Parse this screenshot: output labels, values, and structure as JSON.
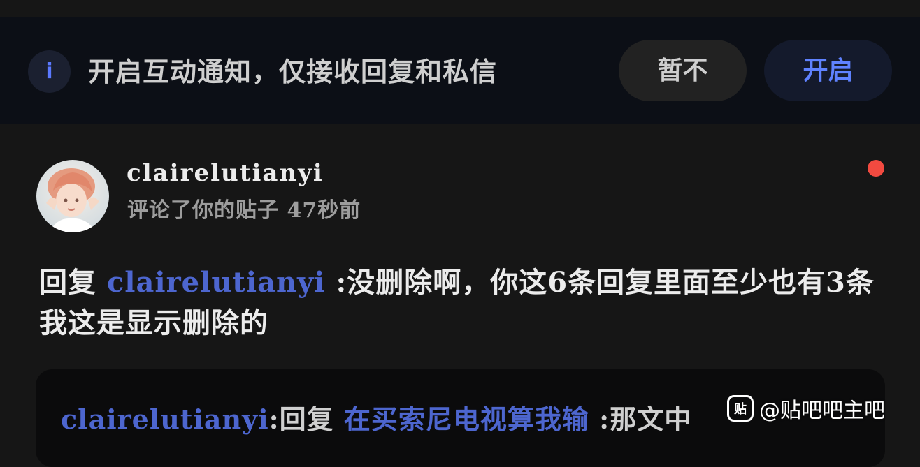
{
  "notice": {
    "icon": "info-icon",
    "icon_glyph": "i",
    "text": "开启互动通知，仅接收回复和私信",
    "later_label": "暂不",
    "enable_label": "开启",
    "accent": "#5f82ff"
  },
  "notification": {
    "avatar_icon": "avatar-photo",
    "username": "clairelutianyi",
    "action": "评论了你的贴子",
    "time": "47秒前",
    "unread_dot_color": "#f24a40",
    "reply_prefix": "回复 ",
    "reply_mention": "clairelutianyi",
    "reply_body": " :没删除啊，你这6条回复里面至少也有3条我这是显示删除的",
    "quote": {
      "user": "clairelutianyi",
      "sep": ":回复 ",
      "link": "在买索尼电视算我输",
      "tail": " :那文中"
    }
  },
  "watermark": {
    "logo_text": "贴",
    "text": "@贴吧吧主吧"
  }
}
